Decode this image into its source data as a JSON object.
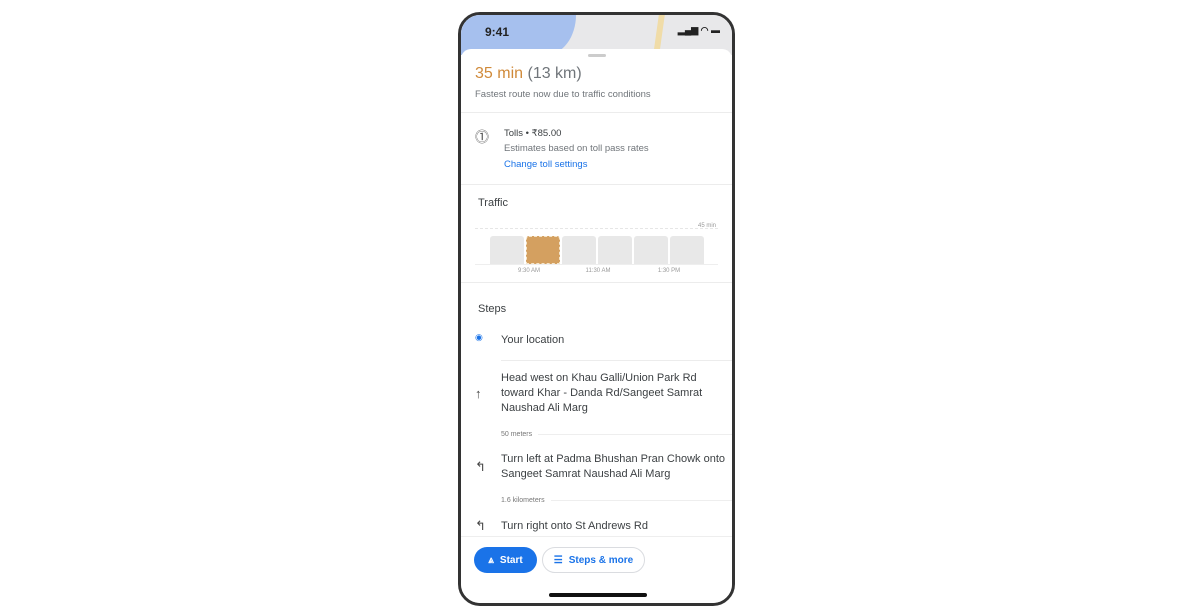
{
  "status_bar": {
    "time": "9:41"
  },
  "summary": {
    "duration": "35 min",
    "distance": "(13 km)",
    "note": "Fastest route now due to traffic conditions",
    "accent": "#d08a3a"
  },
  "tolls": {
    "title": "Tolls • ₹85.00",
    "subtitle": "Estimates based on toll pass rates",
    "link": "Change toll settings",
    "icon": "toll-coins-icon"
  },
  "traffic": {
    "title": "Traffic",
    "max_label": "45 min",
    "ticks": [
      "9:30 AM",
      "11:30 AM",
      "1:30 PM"
    ],
    "selected_bar": 2,
    "bar_count": 6,
    "highlight_color": "#d4a060"
  },
  "steps": {
    "title": "Steps",
    "items": [
      {
        "icon": "location-dot-icon",
        "text": "Your location"
      },
      {
        "icon": "arrow-up-icon",
        "text": "Head west on Khau Galli/Union Park Rd toward Khar - Danda Rd/Sangeet Samrat Naushad Ali Marg",
        "distance": "50 meters"
      },
      {
        "icon": "turn-left-icon",
        "text": "Turn left at Padma Bhushan Pran Chowk onto Sangeet Samrat Naushad Ali Marg",
        "distance": "1.6 kilometers"
      },
      {
        "icon": "turn-right-icon",
        "text": "Turn right onto St Andrews Rd"
      }
    ]
  },
  "actions": {
    "start": "Start",
    "steps_more": "Steps & more",
    "primary_color": "#1a73e8"
  }
}
